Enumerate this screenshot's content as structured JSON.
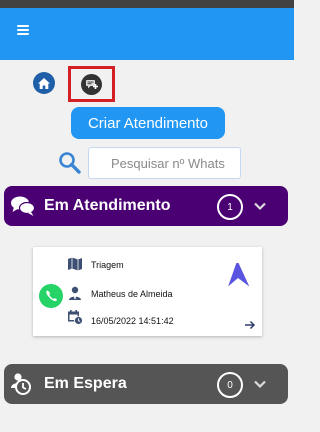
{
  "header": {
    "menu_icon": "hamburger-icon",
    "color": "#2196f3"
  },
  "toolbar": {
    "home_icon": "home-icon",
    "new_chat_icon": "new-chat-icon"
  },
  "create_button": {
    "label": "Criar Atendimento"
  },
  "search": {
    "placeholder": "Pesquisar nº Whats",
    "value": "",
    "icon": "search-icon"
  },
  "sections": {
    "attending": {
      "title": "Em Atendimento",
      "count": "1",
      "color": "#4a0072",
      "icon": "chat-bubbles-icon"
    },
    "waiting": {
      "title": "Em Espera",
      "count": "0",
      "color": "#555555",
      "icon": "clock-user-icon"
    }
  },
  "ticket": {
    "channel_icon": "whatsapp-icon",
    "queue": "Triagem",
    "agent": "Matheus de Almeida",
    "datetime": "16/05/2022 14:51:42"
  }
}
